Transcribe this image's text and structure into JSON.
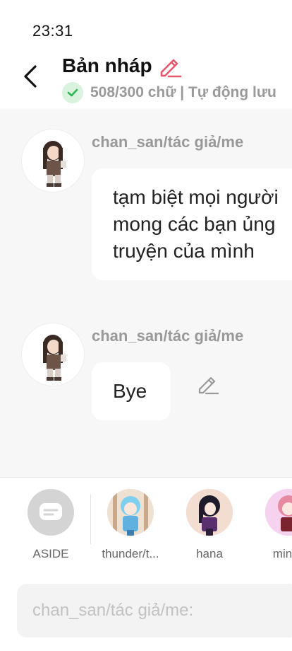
{
  "status": {
    "time": "23:31"
  },
  "header": {
    "title": "Bản nháp",
    "subtitle": "508/300 chữ | Tự động lưu"
  },
  "messages": [
    {
      "sender": "chan_san/tác giả/me",
      "lines": [
        "tạm biệt mọi người",
        "mong các bạn ủng",
        "truyện của mình"
      ]
    },
    {
      "sender": "chan_san/tác giả/me",
      "lines": [
        "Bye"
      ]
    }
  ],
  "characters": [
    {
      "label": "ASIDE"
    },
    {
      "label": "thunder/t..."
    },
    {
      "label": "hana"
    },
    {
      "label": "minaji"
    }
  ],
  "input": {
    "placeholder": "chan_san/tác giả/me:"
  },
  "colors": {
    "accent_pencil": "#e8566b",
    "check_green": "#2fb552"
  }
}
